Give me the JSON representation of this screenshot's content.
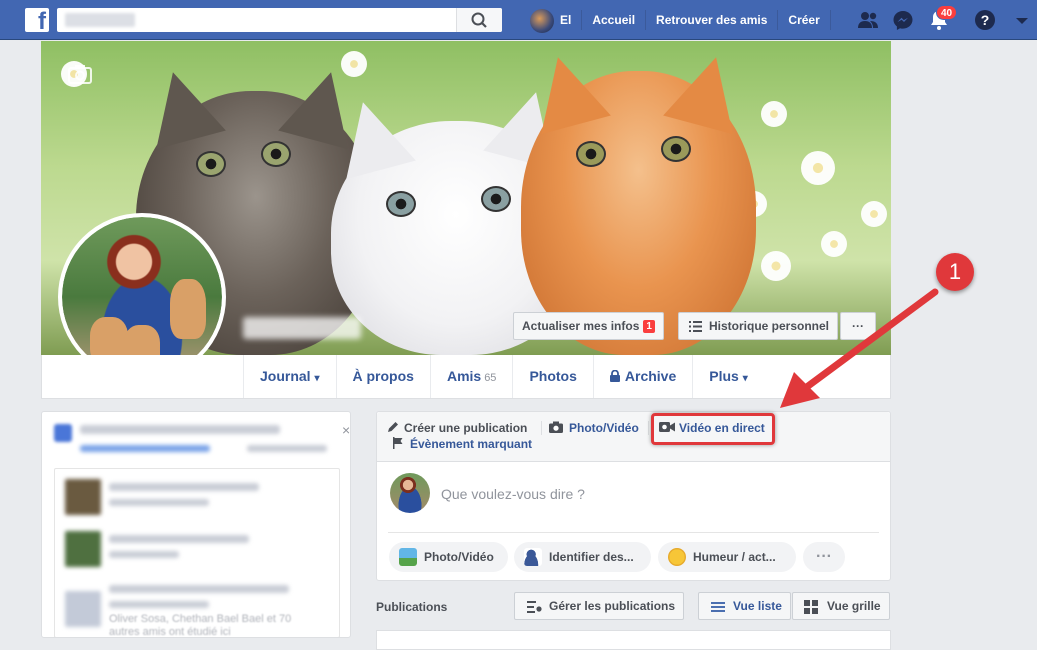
{
  "topbar": {
    "logo": "f",
    "user_name": "El",
    "nav": [
      "Accueil",
      "Retrouver des amis",
      "Créer"
    ],
    "notifications_count": "40"
  },
  "profile": {
    "update_info_label": "Actualiser mes infos",
    "update_info_badge": "1",
    "history_label": "Historique personnel",
    "more_label": "···"
  },
  "tabs": [
    {
      "label": "Journal",
      "suffix": "▾"
    },
    {
      "label": "À propos"
    },
    {
      "label": "Amis",
      "count": "65"
    },
    {
      "label": "Photos"
    },
    {
      "label": "Archive"
    },
    {
      "label": "Plus",
      "suffix": "▾"
    }
  ],
  "composer": {
    "create_post": "Créer une publication",
    "photo_video": "Photo/Vidéo",
    "live_video": "Vidéo en direct",
    "life_event": "Évènement marquant",
    "placeholder": "Que voulez-vous dire ?",
    "actions": [
      "Photo/Vidéo",
      "Identifier des...",
      "Humeur / act...",
      "···"
    ]
  },
  "publications": {
    "label": "Publications",
    "manage": "Gérer les publications",
    "list_view": "Vue liste",
    "grid_view": "Vue grille"
  },
  "left_card": {
    "close": "×",
    "blurred_caption": "Oliver Sosa, Chethan Bael Bael et 70 autres amis ont étudié ici"
  },
  "annotation": {
    "marker": "1"
  },
  "colors": {
    "header": "#4267b2",
    "link": "#365899",
    "highlight": "#e0383b"
  }
}
